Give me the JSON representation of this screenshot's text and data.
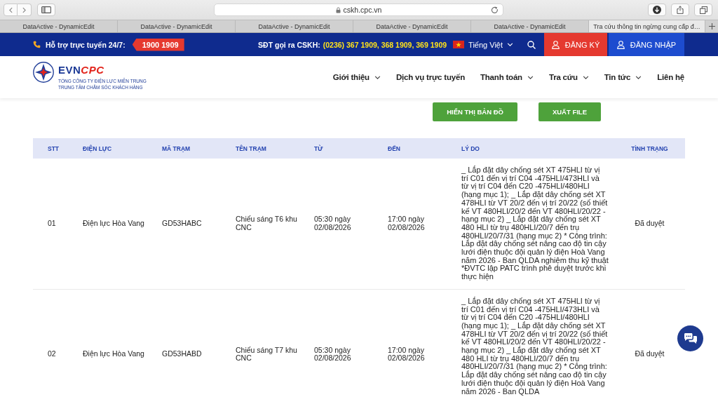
{
  "browser": {
    "address": "cskh.cpc.vn",
    "tabs": [
      {
        "label": "DataActive - DynamicEdit",
        "selected": false
      },
      {
        "label": "DataActive - DynamicEdit",
        "selected": false
      },
      {
        "label": "DataActive - DynamicEdit",
        "selected": false
      },
      {
        "label": "DataActive - DynamicEdit",
        "selected": false
      },
      {
        "label": "DataActive - DynamicEdit",
        "selected": false
      },
      {
        "label": "Tra cứu thông tin ngừng cung cấp đ…",
        "selected": true
      }
    ]
  },
  "top_bar": {
    "support_label": "Hỗ trợ trực tuyến 24/7:",
    "hotline": "1900 1909",
    "cskh_label": "SĐT gọi ra CSKH:",
    "cskh_numbers": "(0236) 367 1909, 368 1909, 369 1909",
    "language": "Tiếng Việt",
    "register_button": "ĐĂNG KÝ",
    "login_button": "ĐĂNG NHẬP"
  },
  "header": {
    "logo": {
      "brand_primary": "EVN",
      "brand_accent": "CPC",
      "line_1": "TỔNG CÔNG TY ĐIỆN LỰC MIỀN TRUNG",
      "line_2": "TRUNG TÂM CHĂM SÓC KHÁCH HÀNG"
    },
    "nav": [
      {
        "label": "Giới thiệu",
        "has_dropdown": true
      },
      {
        "label": "Dịch vụ trực tuyến",
        "has_dropdown": false
      },
      {
        "label": "Thanh toán",
        "has_dropdown": true
      },
      {
        "label": "Tra cứu",
        "has_dropdown": true
      },
      {
        "label": "Tin tức",
        "has_dropdown": true
      },
      {
        "label": "Liên hệ",
        "has_dropdown": false
      }
    ]
  },
  "actions": [
    "HIỂN THỊ BẢN ĐỒ",
    "XUẤT FILE"
  ],
  "table": {
    "columns": [
      "STT",
      "ĐIỆN LỰC",
      "MÃ TRẠM",
      "TÊN TRẠM",
      "TỪ",
      "ĐẾN",
      "LÝ DO",
      "TÌNH TRẠNG"
    ],
    "rows": [
      {
        "cells": [
          "01",
          "Điện lực Hòa Vang",
          "GD53HABC",
          "Chiếu sáng T6 khu CNC",
          "05:30 ngày 02/08/2026",
          "17:00 ngày 02/08/2026",
          "_ Lắp đặt dây chống sét XT 475HLI từ vị trí C01 đến vị trí C04 -475HLI/473HLI và từ vị trí C04 đến C20 -475HLI/480HLI (hạng mục 1); _ Lắp đặt dây chống sét XT 478HLI từ VT 20/2 đến vị trí 20/22 (số thiết kế VT 480HLI/20/2 đến VT 480HLI/20/22 -hạng mục 2) _ Lắp đặt dây chống sét XT 480 HLI từ trụ 480HLI/20/7 đến trụ 480HLI/20/7/31 (hạng mục 2) * Công trình: Lắp đặt dây chống sét nâng cao độ tin cậy lưới điện thuộc đội quản lý điện Hoà Vang năm 2026 - Ban QLDA nghiệm thu kỹ thuật *ĐVTC lập PATC trình phê duyệt trước khi thực hiện",
          "Đã duyệt"
        ]
      },
      {
        "cells": [
          "02",
          "Điện lực Hòa Vang",
          "GD53HABD",
          "Chiếu sáng T7 khu CNC",
          "05:30 ngày 02/08/2026",
          "17:00 ngày 02/08/2026",
          "_ Lắp đặt dây chống sét XT 475HLI từ vị trí C01 đến vị trí C04 -475HLI/473HLI và từ vị trí C04 đến C20 -475HLI/480HLI (hạng mục 1); _ Lắp đặt dây chống sét XT 478HLI từ VT 20/2 đến vị trí 20/22 (số thiết kế VT 480HLI/20/2 đến VT 480HLI/20/22 -hạng mục 2) _ Lắp đặt dây chống sét XT 480 HLI từ trụ 480HLI/20/7 đến trụ 480HLI/20/7/31 (hạng mục 2) * Công trình: Lắp đặt dây chống sét nâng cao độ tin cậy lưới điện thuộc đội quản lý điện Hoà Vang năm 2026 - Ban QLDA",
          "Đã duyệt"
        ]
      }
    ]
  }
}
